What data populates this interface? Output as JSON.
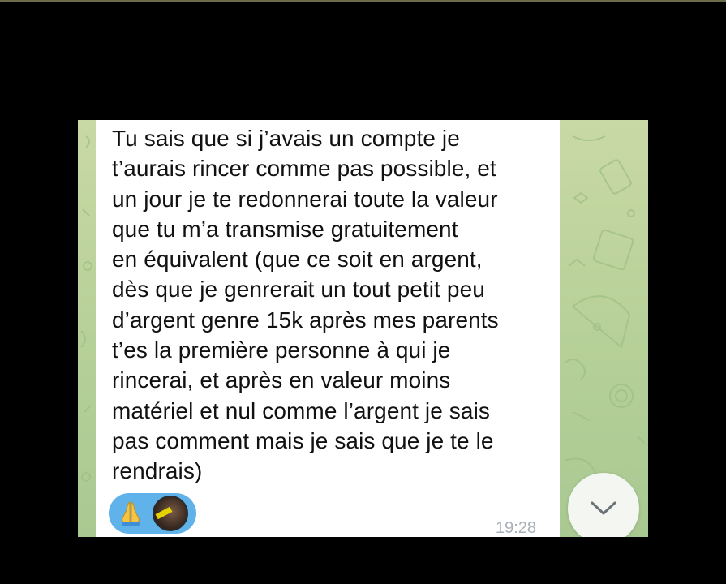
{
  "message": {
    "lines": [
      "Tu sais que si j’avais un compte je",
      "t’aurais rincer comme pas possible, et",
      "un jour je te redonnerai toute la valeur",
      "que tu m’a transmise gratuitement",
      "en équivalent (que ce soit en argent,",
      "dès que je genrerait un tout petit peu",
      "d’argent genre 15k après mes parents",
      "t’es la première personne à qui je",
      "rincerai, et après en valeur moins",
      "matériel et nul comme l’argent je sais",
      "pas comment mais je sais que je te le",
      "rendrais)"
    ],
    "time": "19:28",
    "reactions": [
      {
        "icon": "folded-hands-icon"
      },
      {
        "icon": "user-avatar"
      }
    ]
  },
  "colors": {
    "wallpaper": "#b9d19a",
    "bubble": "#ffffff",
    "reaction_pill": "#5fb3ea",
    "time": "#a7b0b8"
  },
  "scroll_button": {
    "icon": "chevron-down-icon"
  }
}
